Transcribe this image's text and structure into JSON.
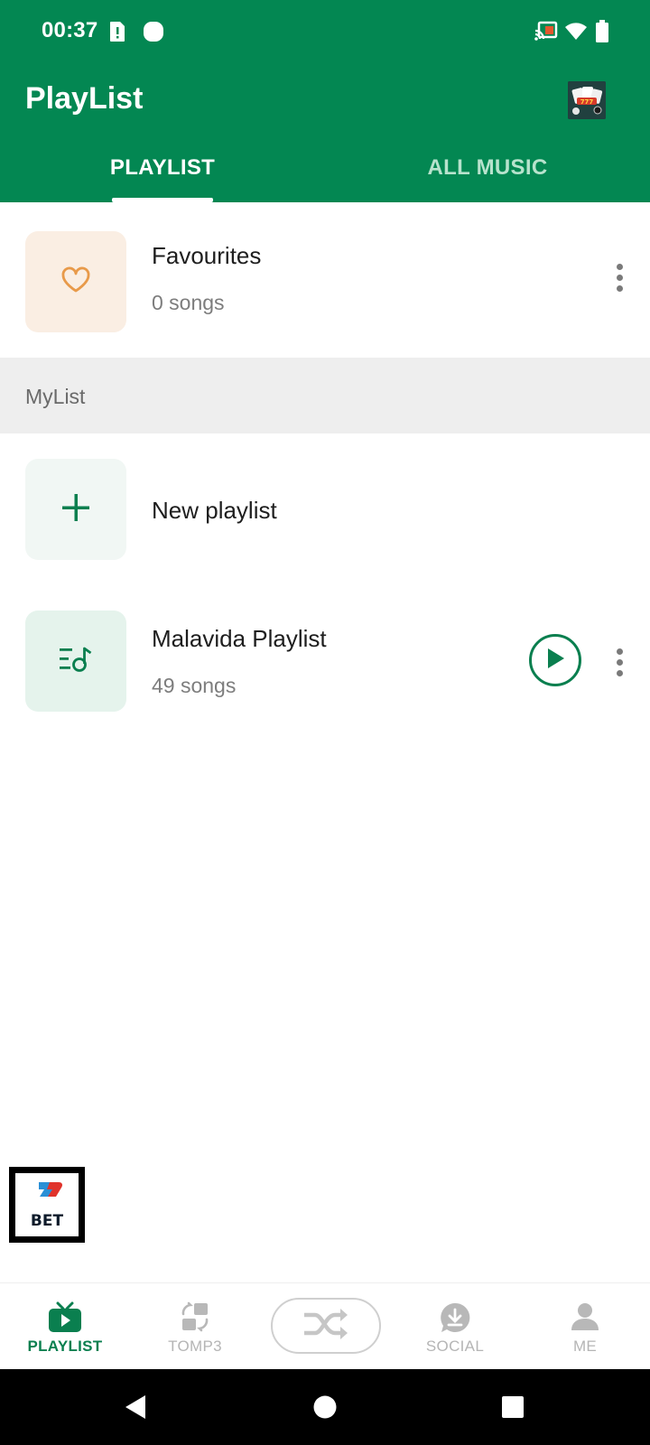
{
  "status_bar": {
    "time": "00:37"
  },
  "app_bar": {
    "title": "PlayList"
  },
  "tabs": [
    {
      "label": "PLAYLIST",
      "selected": true
    },
    {
      "label": "ALL MUSIC",
      "selected": false
    }
  ],
  "favourites": {
    "title": "Favourites",
    "subtitle": "0 songs"
  },
  "section": {
    "label": "MyList"
  },
  "new_playlist": {
    "label": "New playlist"
  },
  "playlists": [
    {
      "title": "Malavida Playlist",
      "subtitle": "49 songs"
    }
  ],
  "ad_badge": {
    "text": "BET"
  },
  "bottom_nav": {
    "items": [
      {
        "label": "PLAYLIST",
        "icon": "tv-play-icon",
        "active": true
      },
      {
        "label": "TOMP3",
        "icon": "convert-icon",
        "active": false
      },
      {
        "label": "",
        "icon": "shuffle-icon",
        "active": false
      },
      {
        "label": "SOCIAL",
        "icon": "download-bubble-icon",
        "active": false
      },
      {
        "label": "ME",
        "icon": "person-icon",
        "active": false
      }
    ]
  },
  "colors": {
    "primary": "#038752",
    "accent": "#0a7f4f",
    "favourite_bg": "#faeee3",
    "heart": "#e89a4a"
  }
}
